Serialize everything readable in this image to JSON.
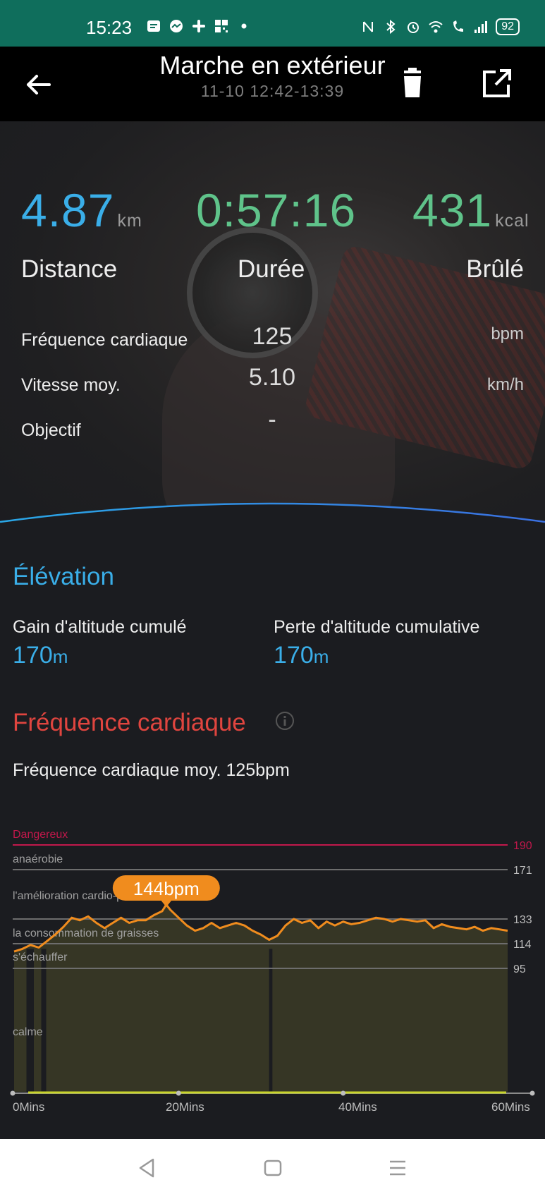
{
  "status_bar": {
    "time": "15:23",
    "battery": "92"
  },
  "app_bar": {
    "title": "Marche en extérieur",
    "subtitle": "11-10 12:42-13:39"
  },
  "summary": {
    "distance": {
      "value": "4.87",
      "unit": "km",
      "label": "Distance",
      "color": "#3aaee8"
    },
    "duration": {
      "value": "0:57:16",
      "label": "Durée",
      "color": "#5fc38a"
    },
    "calories": {
      "value": "431",
      "unit": "kcal",
      "label": "Brûlé",
      "color": "#5fc38a"
    }
  },
  "details": [
    {
      "label": "Fréquence cardiaque",
      "value": "125",
      "unit": "bpm"
    },
    {
      "label": "Vitesse moy.",
      "value": "5.10",
      "unit": "km/h"
    },
    {
      "label": "Objectif",
      "value": "-",
      "unit": ""
    }
  ],
  "elevation": {
    "title": "Élévation",
    "gain_label": "Gain d'altitude cumulé",
    "gain_value": "170",
    "gain_unit": "m",
    "loss_label": "Perte d'altitude cumulative",
    "loss_value": "170",
    "loss_unit": "m",
    "color": "#3aaee8"
  },
  "heart_rate": {
    "title": "Fréquence cardiaque",
    "average_text": "Fréquence cardiaque moy. 125bpm",
    "color": "#e0453f"
  },
  "chart_data": {
    "type": "area",
    "x_ticks": [
      "0Mins",
      "20Mins",
      "40Mins",
      "60Mins"
    ],
    "xlim": [
      0,
      60
    ],
    "zones": [
      {
        "name": "Dangereux",
        "value": 190,
        "color": "#c2184b"
      },
      {
        "name": "anaérobie",
        "value": 171,
        "color": "#9a9a9a"
      },
      {
        "name": "l'amélioration cardio-pulmonaire",
        "value": 152,
        "color": "#9a9a9a"
      },
      {
        "name": "la consommation de graisses",
        "value": 133,
        "color": "#9a9a9a"
      },
      {
        "name": "s'échauffer",
        "value": 114,
        "color": "#9a9a9a"
      },
      {
        "name": "calme",
        "value": 95,
        "color": "#9a9a9a"
      }
    ],
    "y_ticks": [
      190,
      171,
      133,
      114,
      95
    ],
    "peak_label": "144bpm",
    "peak": {
      "x": 18.5,
      "y": 144
    },
    "series": [
      {
        "values": [
          [
            0,
            108
          ],
          [
            1,
            110
          ],
          [
            2,
            113
          ],
          [
            3,
            111
          ],
          [
            4,
            116
          ],
          [
            5,
            121
          ],
          [
            6,
            127
          ],
          [
            7,
            134
          ],
          [
            8,
            132
          ],
          [
            9,
            135
          ],
          [
            10,
            130
          ],
          [
            11,
            126
          ],
          [
            12,
            130
          ],
          [
            13,
            134
          ],
          [
            14,
            130
          ],
          [
            15,
            132
          ],
          [
            16,
            132
          ],
          [
            17,
            136
          ],
          [
            18,
            139
          ],
          [
            18.5,
            144
          ],
          [
            19,
            140
          ],
          [
            20,
            134
          ],
          [
            21,
            128
          ],
          [
            22,
            124
          ],
          [
            23,
            126
          ],
          [
            24,
            130
          ],
          [
            25,
            126
          ],
          [
            26,
            128
          ],
          [
            27,
            130
          ],
          [
            28,
            128
          ],
          [
            29,
            124
          ],
          [
            30,
            121
          ],
          [
            31,
            117
          ],
          [
            32,
            120
          ],
          [
            33,
            128
          ],
          [
            34,
            133
          ],
          [
            35,
            130
          ],
          [
            36,
            132
          ],
          [
            37,
            126
          ],
          [
            38,
            131
          ],
          [
            39,
            128
          ],
          [
            40,
            131
          ],
          [
            41,
            129
          ],
          [
            42,
            130
          ],
          [
            43,
            132
          ],
          [
            44,
            134
          ],
          [
            45,
            133
          ],
          [
            46,
            131
          ],
          [
            47,
            133
          ],
          [
            48,
            132
          ],
          [
            49,
            131
          ],
          [
            50,
            132
          ],
          [
            51,
            126
          ],
          [
            52,
            129
          ],
          [
            53,
            127
          ],
          [
            54,
            126
          ],
          [
            55,
            125
          ],
          [
            56,
            127
          ],
          [
            57,
            124
          ],
          [
            58,
            126
          ],
          [
            59,
            125
          ],
          [
            60,
            124
          ]
        ]
      }
    ],
    "line_color": "#f08c1e",
    "fill_color": "#3a3a26"
  }
}
